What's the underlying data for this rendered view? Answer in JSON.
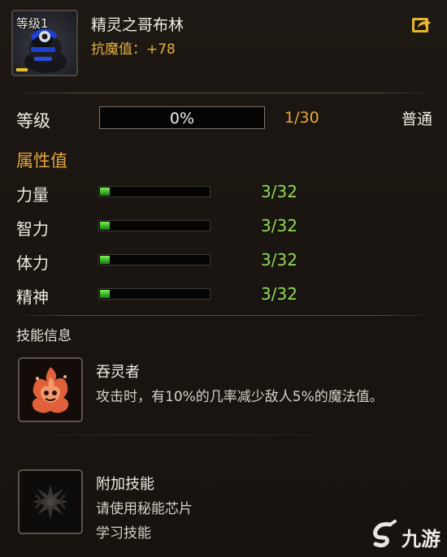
{
  "header": {
    "portrait_level": "等级1",
    "pet_name": "精灵之哥布林",
    "magic_resist": "抗魔值：+78",
    "share_icon": "share-icon"
  },
  "level": {
    "label": "等级",
    "progress_text": "0%",
    "progress_fraction": 0.0,
    "count": "1/30",
    "quality": "普通"
  },
  "attributes": {
    "title": "属性值",
    "stats": [
      {
        "label": "力量",
        "value": "3/32",
        "fraction": 0.094
      },
      {
        "label": "智力",
        "value": "3/32",
        "fraction": 0.094
      },
      {
        "label": "体力",
        "value": "3/32",
        "fraction": 0.094
      },
      {
        "label": "精神",
        "value": "3/32",
        "fraction": 0.094
      }
    ]
  },
  "skills": {
    "title": "技能信息",
    "items": [
      {
        "name": "吞灵者",
        "desc": "攻击时，有10%的几率减少敌人5%的魔法值。",
        "desc2": "",
        "icon": "flame-spirit-icon"
      },
      {
        "name": "附加技能",
        "desc": "请使用秘能芯片",
        "desc2": "学习技能",
        "icon": "locked-skill-icon"
      }
    ]
  },
  "watermark": {
    "text": "九游",
    "icon": "jiuyou-logo-icon"
  },
  "colors": {
    "accent_gold": "#e8a53a",
    "stat_green": "#8fd85a",
    "bar_fill_green": "#35b222"
  }
}
